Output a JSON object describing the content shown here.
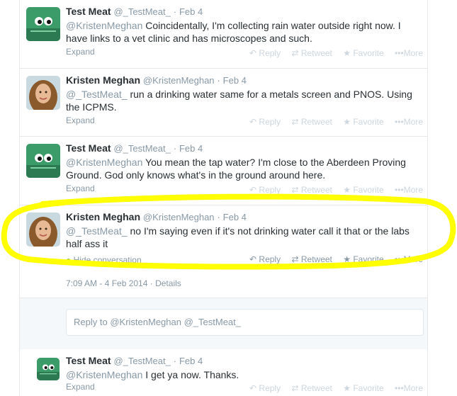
{
  "tweets": [
    {
      "fullname": "Test Meat",
      "username": "@_TestMeat_",
      "dot": "·",
      "time": "Feb 4",
      "mention": "@KristenMeghan",
      "text": " Coincidentally, I'm collecting rain water outside right now. I have links to a vet clinic and has microscopes and such.",
      "expand": "Expand"
    },
    {
      "fullname": "Kristen Meghan",
      "username": "@KristenMeghan",
      "dot": "·",
      "time": "Feb 4",
      "mention": "@_TestMeat_",
      "text": " run a drinking water same for a metals screen and PNOS. Using the ICPMS.",
      "expand": "Expand"
    },
    {
      "fullname": "Test Meat",
      "username": "@_TestMeat_",
      "dot": "·",
      "time": "Feb 4",
      "mention": "@KristenMeghan",
      "text": " You mean the tap water?  I'm close to the Aberdeen Proving Ground.  God only knows what's in the ground around here.",
      "expand": "Expand"
    },
    {
      "fullname": "Kristen Meghan",
      "username": "@KristenMeghan",
      "dot": "·",
      "time": "Feb 4",
      "mention": "@_TestMeat_",
      "text": " no I'm saying even if it's not drinking water call it that or the labs half ass it",
      "hide_conversation": "Hide conversation",
      "timestamp_detail": "7:09 AM - 4 Feb 2014",
      "details_sep": "·",
      "details": "Details"
    },
    {
      "fullname": "Test Meat",
      "username": "@_TestMeat_",
      "dot": "·",
      "time": "Feb 4",
      "mention": "@KristenMeghan",
      "text": " I get ya now.  Thanks.",
      "expand": "Expand"
    }
  ],
  "actions": {
    "reply": "Reply",
    "retweet": "Retweet",
    "favorite": "Favorite",
    "more": "More"
  },
  "icons": {
    "reply": "↶",
    "retweet": "⇄",
    "favorite": "★",
    "more": "•••",
    "conversation": "speech-bubble-icon"
  },
  "reply_box": {
    "prefix": "Reply to",
    "mention1": "@KristenMeghan",
    "mention2": "@_TestMeat_"
  },
  "colors": {
    "highlight": "#ffff00",
    "mention": "#8899a6",
    "muted": "#8899a6",
    "action_faded": "#cdd6dd",
    "conversation_green": "#8cc63f"
  }
}
